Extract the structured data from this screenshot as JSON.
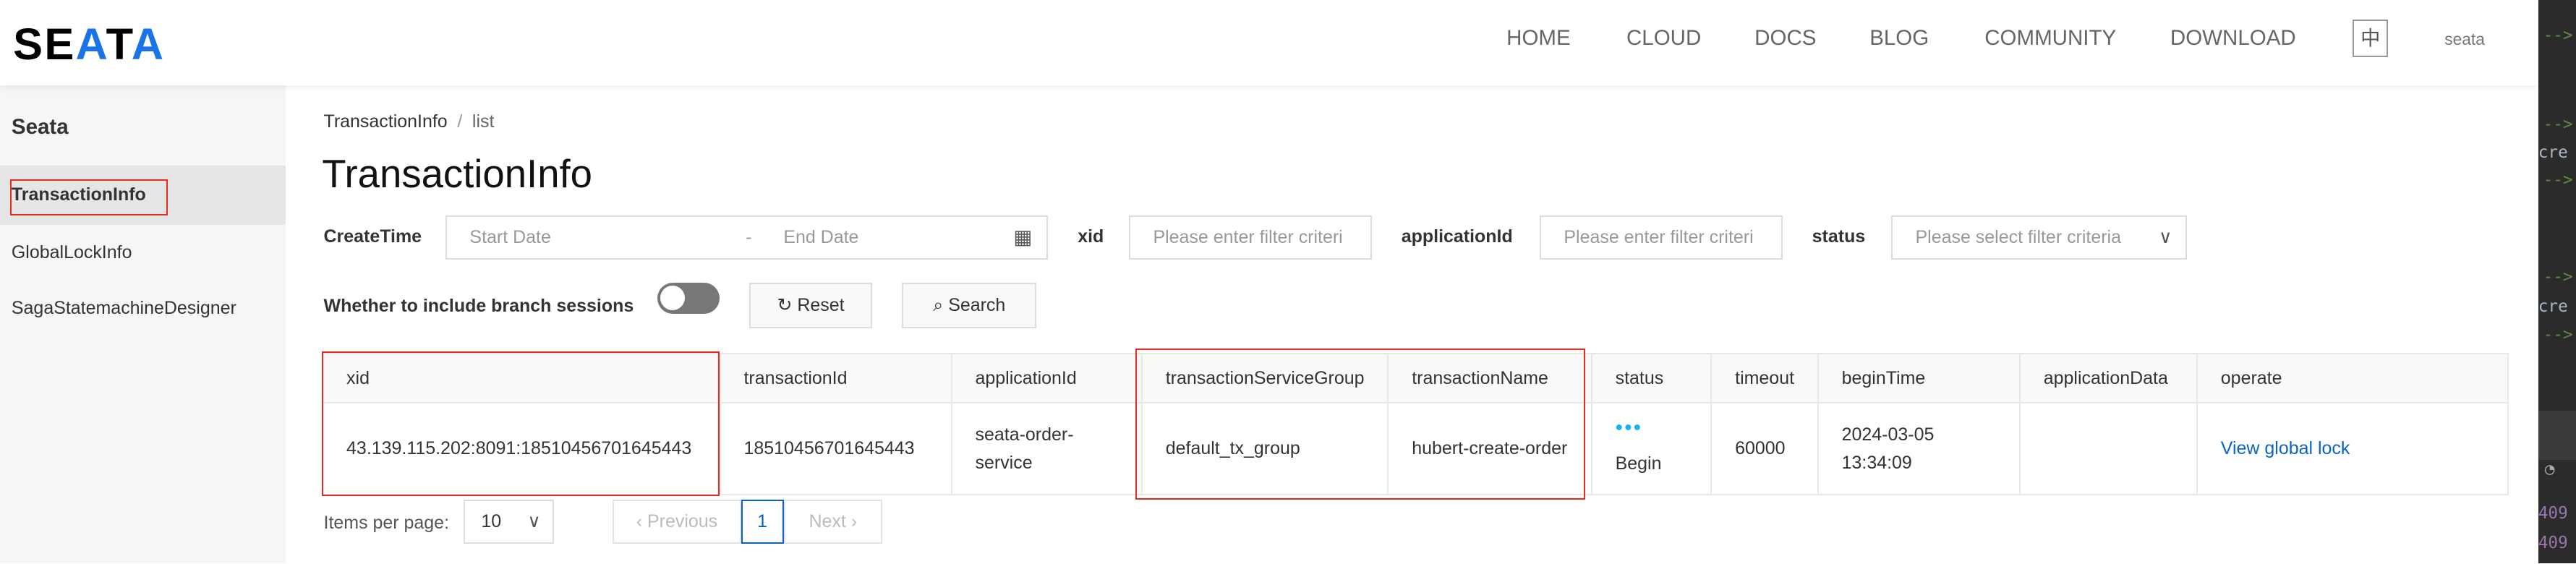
{
  "header": {
    "logo": "SEATA",
    "nav": [
      "HOME",
      "CLOUD",
      "DOCS",
      "BLOG",
      "COMMUNITY",
      "DOWNLOAD"
    ],
    "lang": "中",
    "user": "seata"
  },
  "sidebar": {
    "title": "Seata",
    "items": [
      {
        "label": "TransactionInfo",
        "selected": true
      },
      {
        "label": "GlobalLockInfo"
      },
      {
        "label": "SagaStatemachineDesigner"
      }
    ]
  },
  "breadcrumb": {
    "parent": "TransactionInfo",
    "sep": "/",
    "current": "list"
  },
  "page_title": "TransactionInfo",
  "filters": {
    "create_time_label": "CreateTime",
    "start_placeholder": "Start Date",
    "range_sep": "-",
    "end_placeholder": "End Date",
    "xid_label": "xid",
    "xid_placeholder": "Please enter filter criteri",
    "app_label": "applicationId",
    "app_placeholder": "Please enter filter criteri",
    "status_label": "status",
    "status_placeholder": "Please select filter criteria",
    "branch_label": "Whether to include branch sessions",
    "branch_on": false,
    "reset": "Reset",
    "search": "Search"
  },
  "table": {
    "columns": [
      "xid",
      "transactionId",
      "applicationId",
      "transactionServiceGroup",
      "transactionName",
      "status",
      "timeout",
      "beginTime",
      "applicationData",
      "operate"
    ],
    "rows": [
      {
        "xid": "43.139.115.202:8091:18510456701645443",
        "transactionId": "18510456701645443",
        "applicationId": "seata-order-service",
        "transactionServiceGroup": "default_tx_group",
        "transactionName": "hubert-create-order",
        "status_dots": "•••",
        "status": "Begin",
        "timeout": "60000",
        "beginDate": "2024-03-05",
        "beginClock": "13:34:09",
        "applicationData": "",
        "operate": "View global lock"
      }
    ]
  },
  "pagination": {
    "label": "Items per page:",
    "page_size": "10",
    "prev": "Previous",
    "current": "1",
    "next": "Next"
  },
  "code_panel": [
    "-->",
    "-->",
    "cre",
    "-->",
    "-->",
    "cre",
    "-->",
    "409",
    "409"
  ],
  "colors": {
    "accent": "#1a73e8",
    "highlight": "#e8291c",
    "link": "#0a64c4"
  }
}
